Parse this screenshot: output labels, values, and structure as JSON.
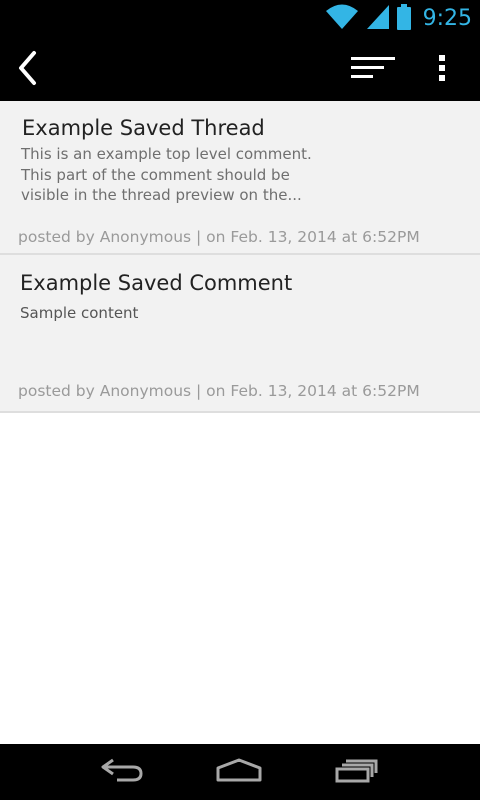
{
  "status_bar": {
    "time": "9:25",
    "icons": [
      "wifi-icon",
      "signal-icon",
      "battery-icon"
    ],
    "accent_color": "#33b5e5"
  },
  "action_bar": {
    "icons": [
      "back-icon",
      "sort-icon",
      "overflow-menu-icon"
    ]
  },
  "items": [
    {
      "title": "Example Saved Thread",
      "preview": "This is an example top level comment. This part of the comment should be visible in the thread preview on the...",
      "meta": "posted by Anonymous | on Feb. 13, 2014 at 6:52PM"
    },
    {
      "title": "Example Saved Comment",
      "preview": "Sample content",
      "meta": "posted by Anonymous | on Feb. 13, 2014 at 6:52PM"
    }
  ],
  "nav_bar": {
    "icons": [
      "back-nav-icon",
      "home-nav-icon",
      "recent-apps-icon"
    ]
  }
}
